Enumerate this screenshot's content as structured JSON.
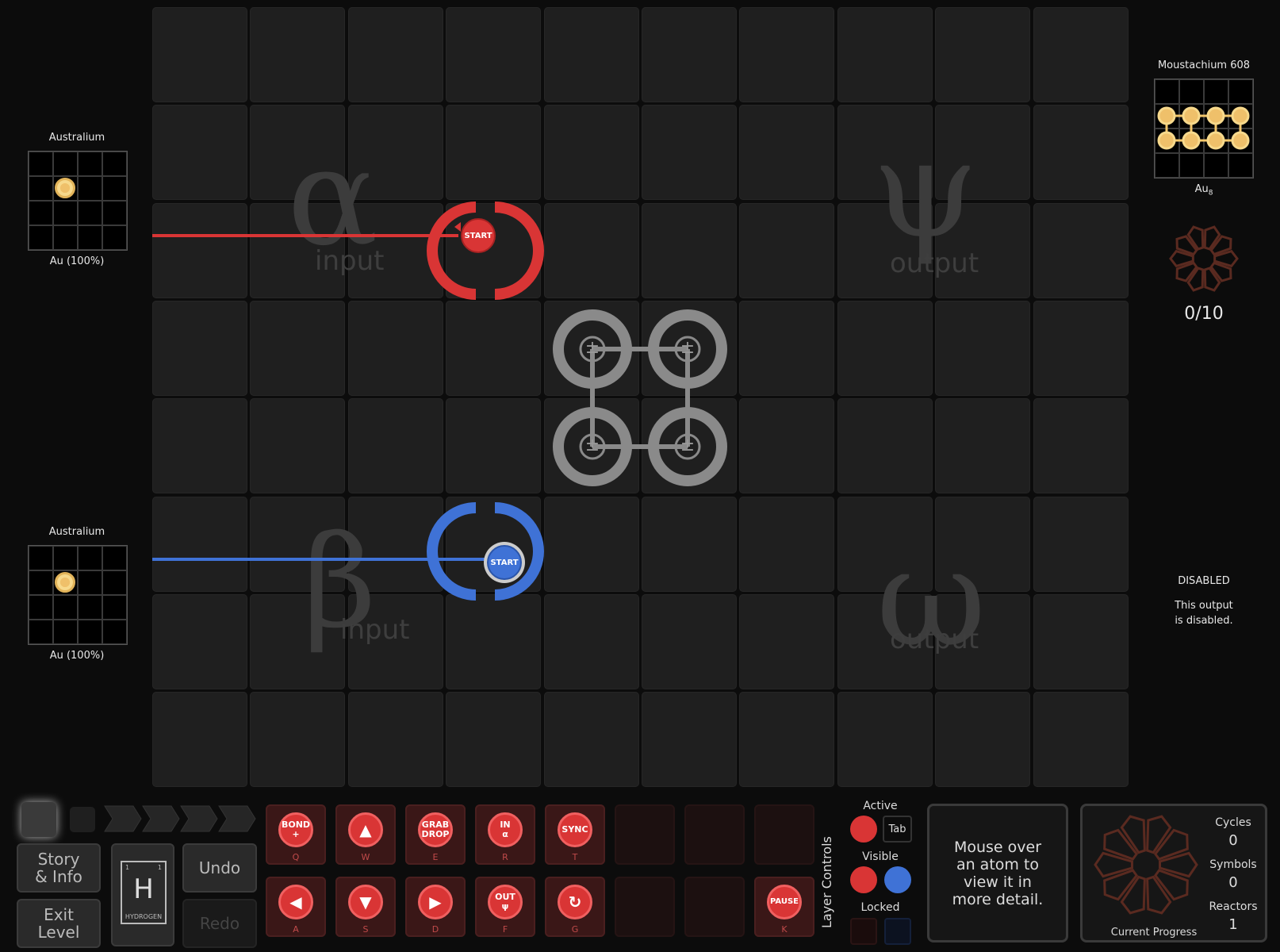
{
  "left_inputs": [
    {
      "title": "Australium",
      "caption": "Au (100%)"
    },
    {
      "title": "Australium",
      "caption": "Au (100%)"
    }
  ],
  "output_target": {
    "title": "Moustachium 608",
    "formula_base": "Au",
    "formula_sub": "8",
    "progress": "0/10"
  },
  "disabled_output": {
    "title": "DISABLED",
    "line1": "This output",
    "line2": "is disabled."
  },
  "zones": {
    "alpha": {
      "symbol": "α",
      "label": "input"
    },
    "beta": {
      "symbol": "β",
      "label": "input"
    },
    "psi": {
      "symbol": "ψ",
      "label": "output"
    },
    "omega": {
      "symbol": "ω",
      "label": "output"
    }
  },
  "waldos": {
    "red": {
      "start_label": "START",
      "color": "#d93535"
    },
    "blue": {
      "start_label": "START",
      "color": "#3f72d6"
    }
  },
  "bonder_symbol": "±",
  "controls": {
    "story_label_1": "Story",
    "story_label_2": "& Info",
    "exit_label_1": "Exit",
    "exit_label_2": "Level",
    "undo_label": "Undo",
    "redo_label": "Redo",
    "element": {
      "symbol": "H",
      "name": "HYDROGEN",
      "num_left": "1",
      "num_right": "1"
    }
  },
  "instructions_top": [
    {
      "label_1": "BOND",
      "label_2": "+",
      "key": "Q"
    },
    {
      "label_1": "▲",
      "label_2": "",
      "key": "W",
      "arrow": true
    },
    {
      "label_1": "GRAB",
      "label_2": "DROP",
      "key": "E"
    },
    {
      "label_1": "IN",
      "label_2": "α",
      "key": "R"
    },
    {
      "label_1": "SYNC",
      "label_2": "",
      "key": "T"
    }
  ],
  "instructions_bottom": [
    {
      "label_1": "◀",
      "label_2": "",
      "key": "A",
      "arrow": true
    },
    {
      "label_1": "▼",
      "label_2": "",
      "key": "S",
      "arrow": true
    },
    {
      "label_1": "▶",
      "label_2": "",
      "key": "D",
      "arrow": true
    },
    {
      "label_1": "OUT",
      "label_2": "ψ",
      "key": "F"
    },
    {
      "label_1": "↻",
      "label_2": "",
      "key": "G",
      "arrow": true
    }
  ],
  "pause": {
    "label": "PAUSE",
    "key": "K"
  },
  "layer_controls": {
    "title": "Layer Controls",
    "active_label": "Active",
    "tab_label": "Tab",
    "visible_label": "Visible",
    "locked_label": "Locked",
    "red": "#d93535",
    "blue": "#3f72d6"
  },
  "info_text": {
    "l1": "Mouse over",
    "l2": "an atom to",
    "l3": "view it in",
    "l4": "more detail."
  },
  "stats": {
    "cycles_label": "Cycles",
    "cycles_value": "0",
    "symbols_label": "Symbols",
    "symbols_value": "0",
    "reactors_label": "Reactors",
    "reactors_value": "1",
    "progress_label": "Current Progress"
  }
}
